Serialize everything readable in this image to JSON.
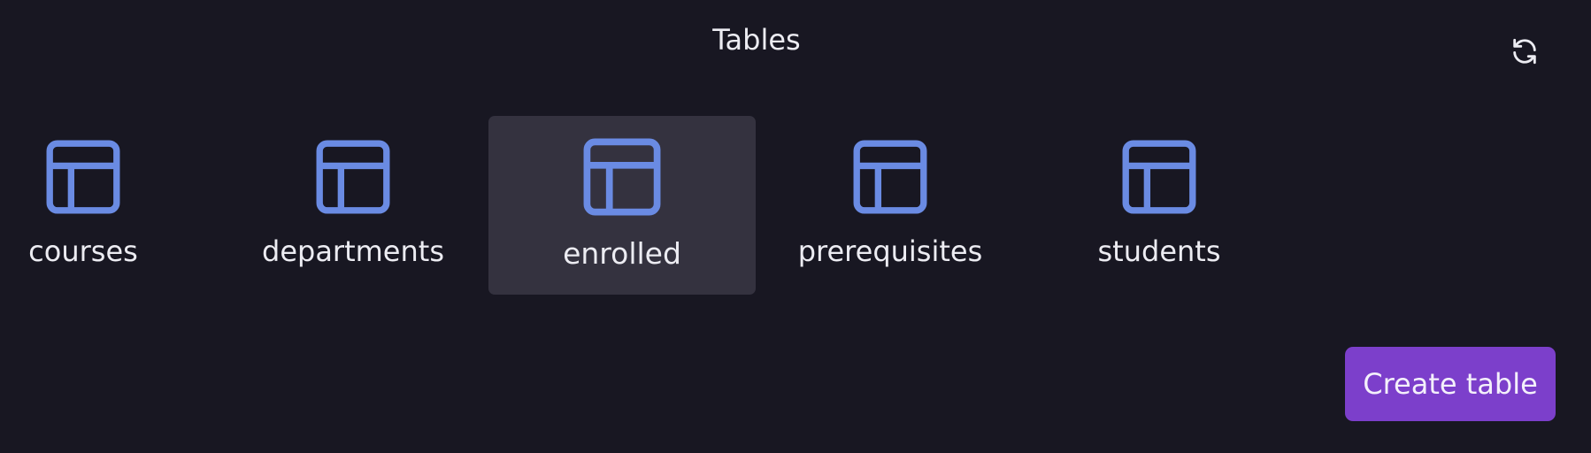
{
  "header": {
    "title": "Tables",
    "refresh_icon": "refresh-icon"
  },
  "tables": [
    {
      "name": "courses",
      "icon": "table-icon",
      "selected": false
    },
    {
      "name": "departments",
      "icon": "table-icon",
      "selected": false
    },
    {
      "name": "enrolled",
      "icon": "table-icon",
      "selected": true
    },
    {
      "name": "prerequisites",
      "icon": "table-icon",
      "selected": false
    },
    {
      "name": "students",
      "icon": "table-icon",
      "selected": false
    }
  ],
  "actions": {
    "create_label": "Create table"
  },
  "colors": {
    "background": "#181722",
    "selected_background": "#34323f",
    "icon": "#6a8be3",
    "button": "#7c3fcb",
    "text": "#ececf2"
  }
}
